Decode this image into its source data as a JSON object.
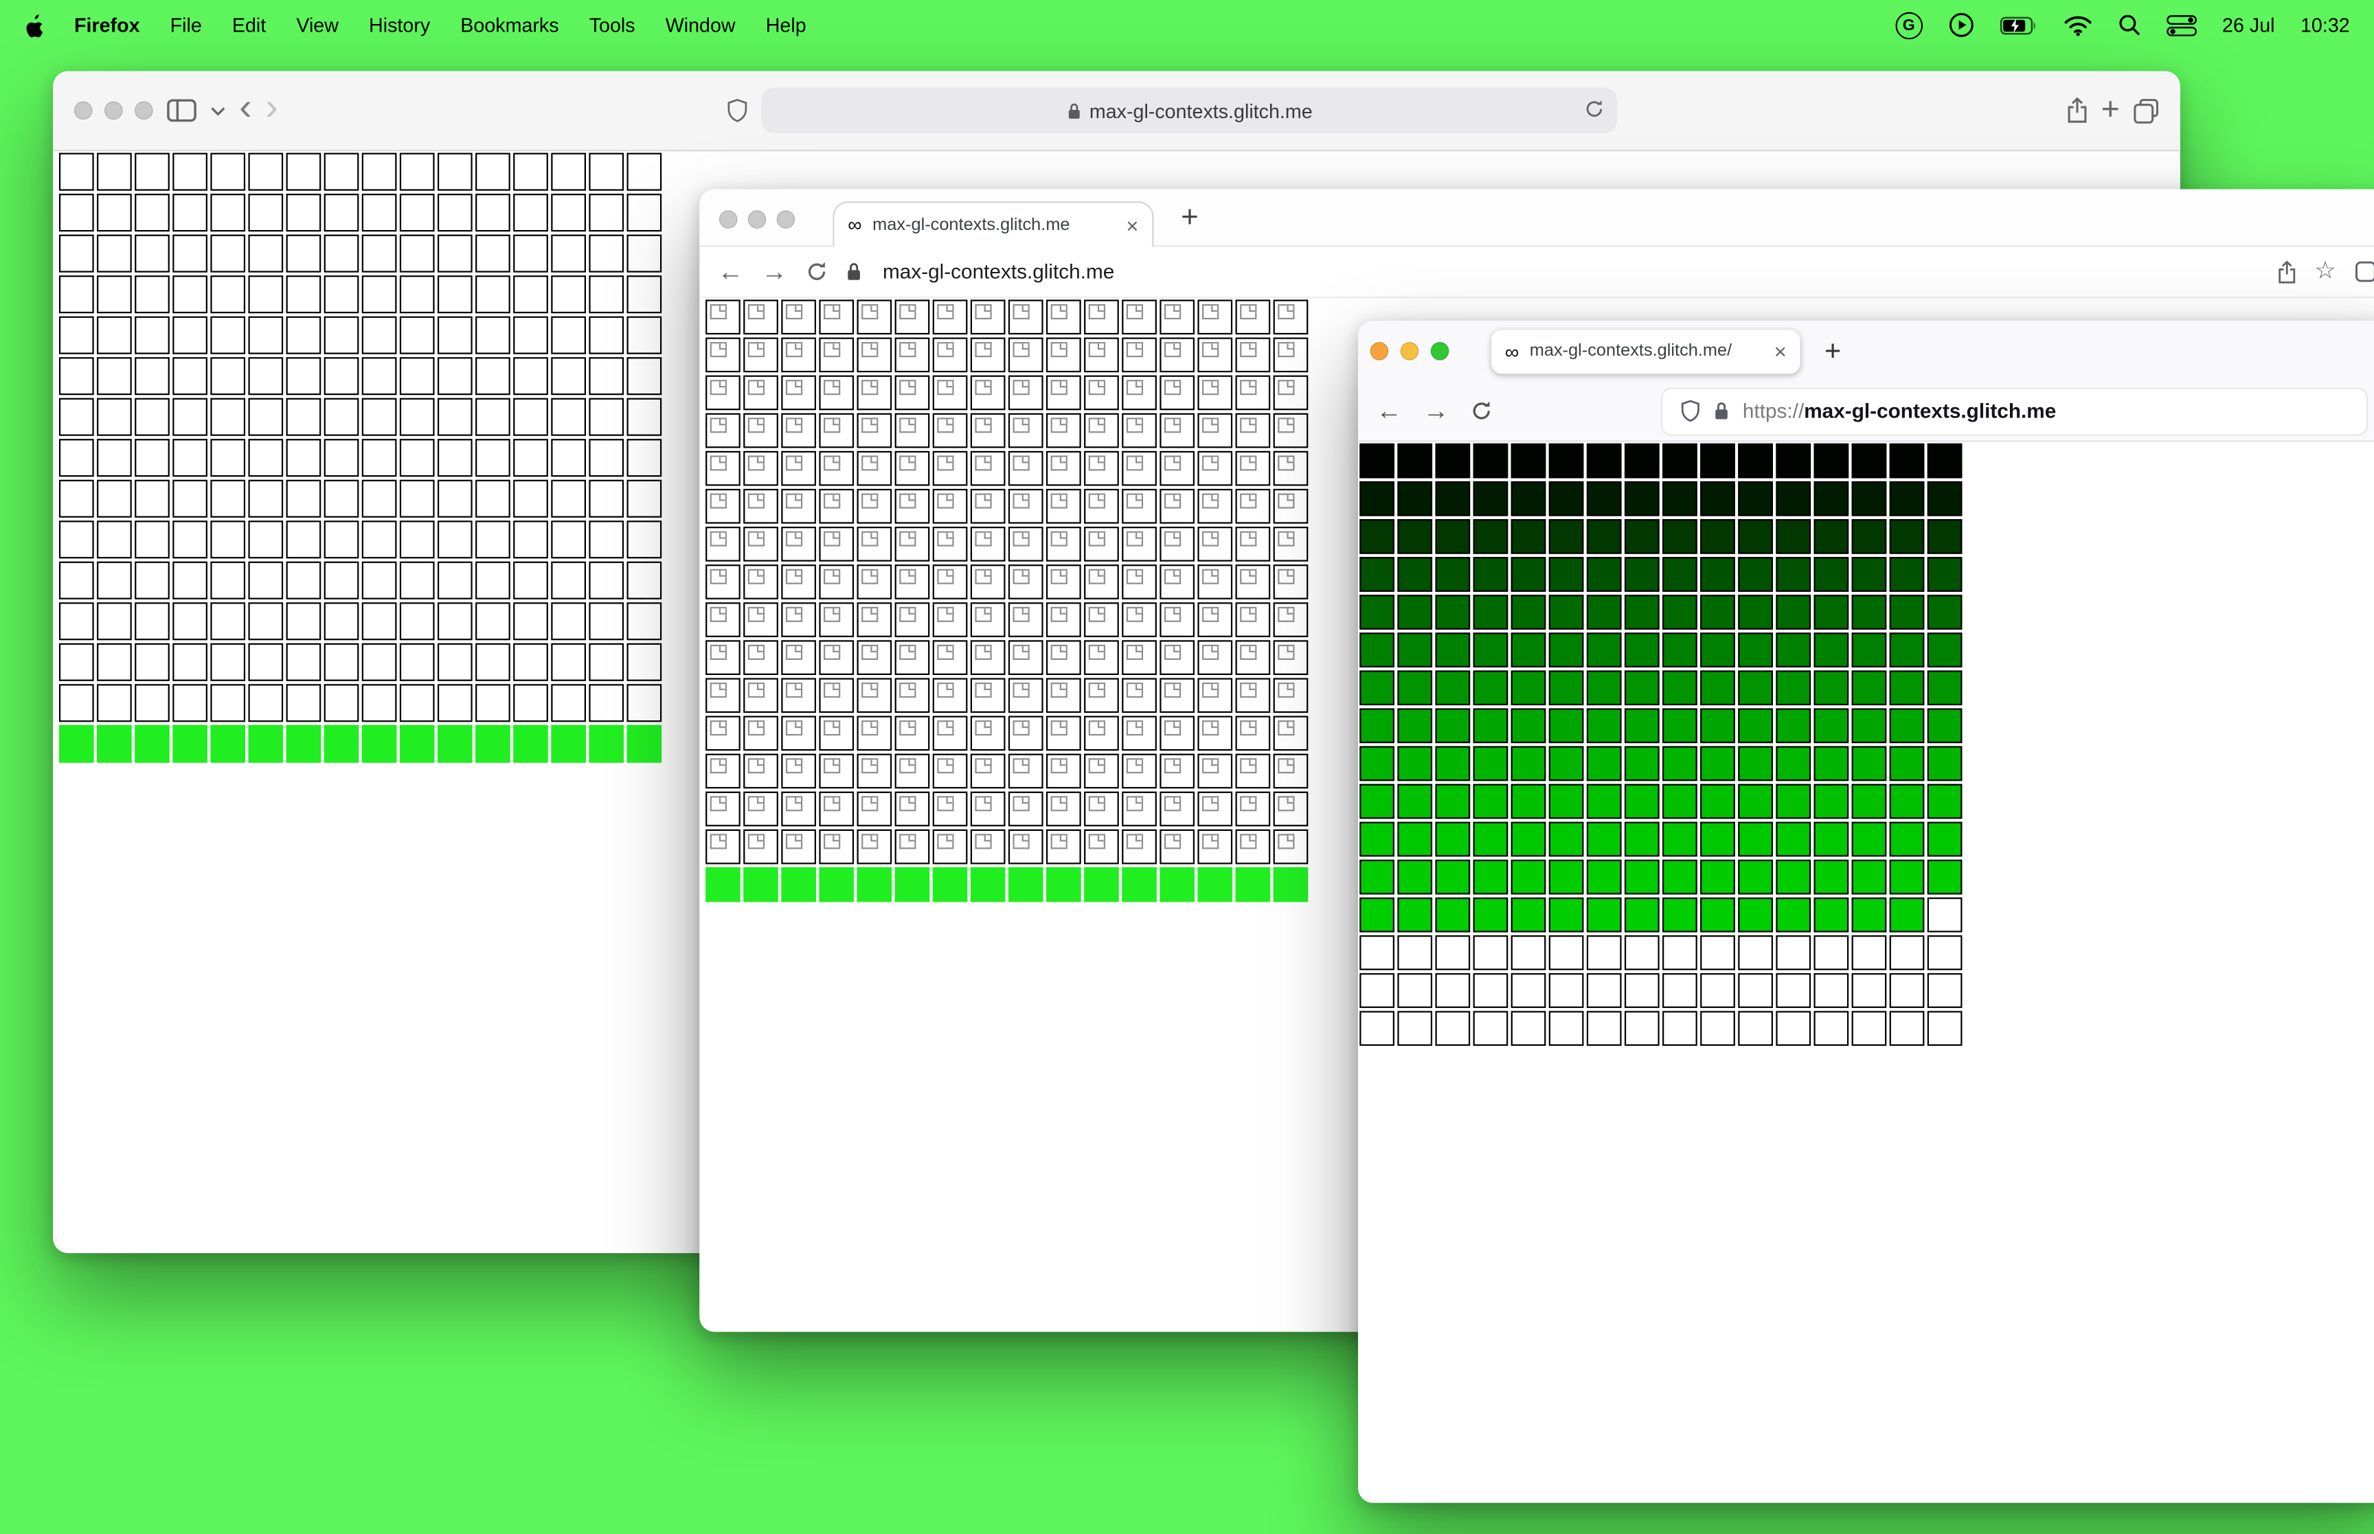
{
  "colors": {
    "desktop_green": "#5ef65c",
    "canvas_green": "#21ee21",
    "webgl_bright_green": "#00cc00"
  },
  "menubar": {
    "app_name": "Firefox",
    "menus": [
      "File",
      "Edit",
      "View",
      "History",
      "Bookmarks",
      "Tools",
      "Window",
      "Help"
    ],
    "grammarly_label": "G",
    "date": "26 Jul",
    "time": "10:32"
  },
  "safari": {
    "url": "max-gl-contexts.glitch.me",
    "grid": {
      "cols": 16,
      "rows": [
        {
          "color": "#ffffff",
          "count": 14
        },
        {
          "color": "#21ee21",
          "count": 1,
          "no_border": true
        }
      ]
    }
  },
  "chrome": {
    "tab_title": "max-gl-contexts.glitch.me",
    "url": "max-gl-contexts.glitch.me",
    "grid": {
      "cols": 16,
      "rows": [
        {
          "color": "#ffffff",
          "count": 15,
          "broken": true
        },
        {
          "color": "#21ee21",
          "count": 1,
          "no_border": true
        }
      ]
    }
  },
  "firefox": {
    "tab_title": "max-gl-contexts.glitch.me/",
    "url_scheme": "https://",
    "url_host": "max-gl-contexts.glitch.me",
    "grid": {
      "cols": 16,
      "rows": [
        {
          "color": "#000300"
        },
        {
          "color": "#001c00"
        },
        {
          "color": "#003800"
        },
        {
          "color": "#005200"
        },
        {
          "color": "#006a00"
        },
        {
          "color": "#008000"
        },
        {
          "color": "#009400"
        },
        {
          "color": "#00a600"
        },
        {
          "color": "#00b400"
        },
        {
          "color": "#00c000"
        },
        {
          "color": "#00c800"
        },
        {
          "color": "#00cc00"
        },
        {
          "color": "#00ce00",
          "last_white": 1
        },
        {
          "color": "#ffffff",
          "count": 3
        }
      ]
    }
  }
}
